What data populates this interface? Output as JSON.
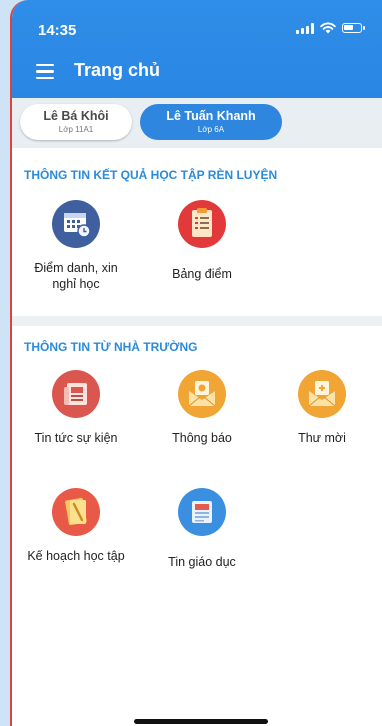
{
  "status": {
    "time": "14:35"
  },
  "header": {
    "title": "Trang chủ"
  },
  "tabs": [
    {
      "name": "Lê Bá Khôi",
      "class": "Lớp 11A1"
    },
    {
      "name": "Lê Tuấn Khanh",
      "class": "Lớp 6A"
    }
  ],
  "sections": [
    {
      "title": "THÔNG TIN KẾT QUẢ HỌC TẬP RÈN LUYỆN",
      "items": [
        {
          "label": "Điểm danh, xin nghỉ học",
          "icon": "calendar-clock-icon"
        },
        {
          "label": "Bảng điểm",
          "icon": "scoreboard-icon"
        }
      ]
    },
    {
      "title": "THÔNG TIN TỪ NHÀ TRƯỜNG",
      "items": [
        {
          "label": "Tin tức sự kiện",
          "icon": "newspaper-icon"
        },
        {
          "label": "Thông báo",
          "icon": "notification-envelope-icon"
        },
        {
          "label": "Thư mời",
          "icon": "invitation-envelope-icon"
        },
        {
          "label": "Kế hoạch học tập",
          "icon": "study-plan-icon"
        },
        {
          "label": "Tin giáo dục",
          "icon": "education-news-icon"
        }
      ]
    }
  ],
  "colors": {
    "header": "#2a86e3",
    "active_tab": "#2e86de",
    "section_title": "#2b8ad9",
    "calendar_icon": "#3f5f9e",
    "scoreboard_icon": "#e23a3a",
    "news_icon": "#d9574f",
    "notification_icon": "#f0a535",
    "invitation_icon": "#f0a535",
    "plan_icon": "#e85a47",
    "education_icon": "#3b8fe0"
  }
}
